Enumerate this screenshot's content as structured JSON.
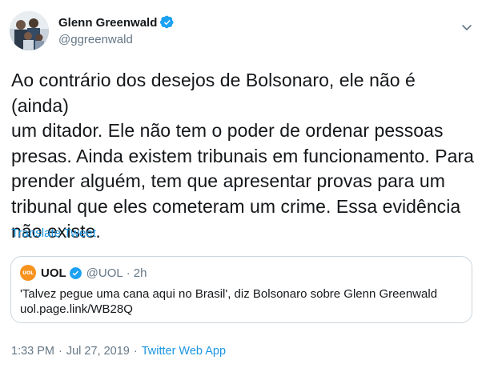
{
  "author": {
    "name": "Glenn Greenwald",
    "handle": "@ggreenwald"
  },
  "tweet": {
    "lines": [
      "Ao contrário dos desejos de Bolsonaro, ele não é (ainda)",
      "um ditador. Ele não tem o poder de ordenar pessoas",
      "presas. Ainda existem tribunais em funcionamento. Para",
      "prender alguém, tem que apresentar provas para um",
      "tribunal que eles cometeram um crime. Essa evidência",
      "não existe."
    ],
    "translate_label": "Translate Tweet"
  },
  "quoted": {
    "logo_text": "UOL",
    "name": "UOL",
    "handle": "@UOL",
    "separator": "·",
    "time": "2h",
    "text": "'Talvez pegue uma cana aqui no Brasil', diz Bolsonaro sobre Glenn Greenwald",
    "link": "uol.page.link/WB28Q"
  },
  "meta": {
    "time": "1:33 PM",
    "date": "Jul 27, 2019",
    "separator": "·",
    "source": "Twitter Web App"
  },
  "colors": {
    "link": "#1b95e0",
    "verified": "#1da1f2",
    "uol_orange": "#f7931e",
    "muted": "#657786"
  },
  "icons": [
    "verified-badge-icon",
    "chevron-down-icon",
    "uol-logo-icon"
  ]
}
